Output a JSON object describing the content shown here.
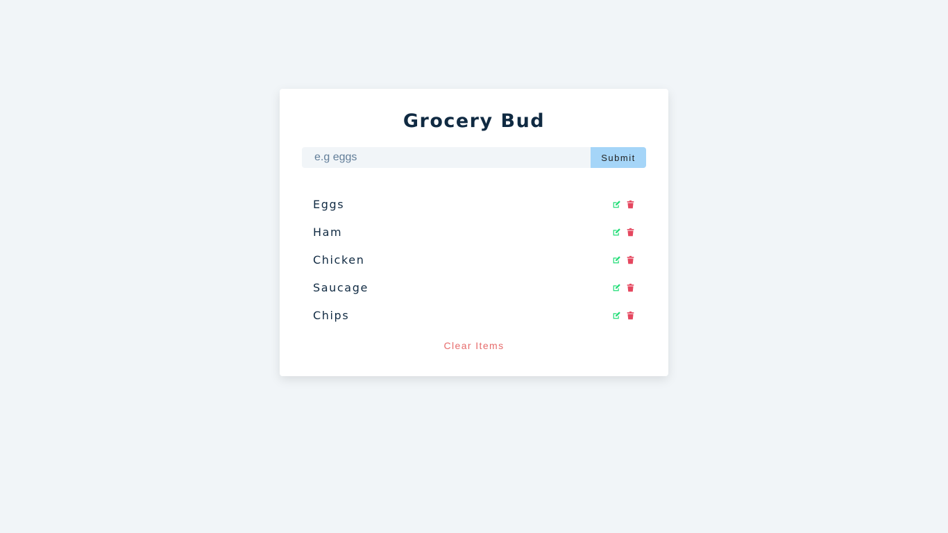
{
  "app": {
    "title": "Grocery Bud"
  },
  "form": {
    "placeholder": "e.g eggs",
    "value": "",
    "submit_label": "Submit"
  },
  "items": [
    {
      "title": "Eggs"
    },
    {
      "title": "Ham"
    },
    {
      "title": "Chicken"
    },
    {
      "title": "Saucage"
    },
    {
      "title": "Chips"
    }
  ],
  "clear_label": "Clear Items",
  "colors": {
    "background": "#f1f5f8",
    "card": "#ffffff",
    "title": "#102a42",
    "submit": "#a5d5f8",
    "edit_icon": "#22dd77",
    "delete_icon": "#e5475f",
    "clear": "#e66b6b"
  },
  "icons": {
    "edit": "edit-icon",
    "delete": "trash-icon"
  }
}
